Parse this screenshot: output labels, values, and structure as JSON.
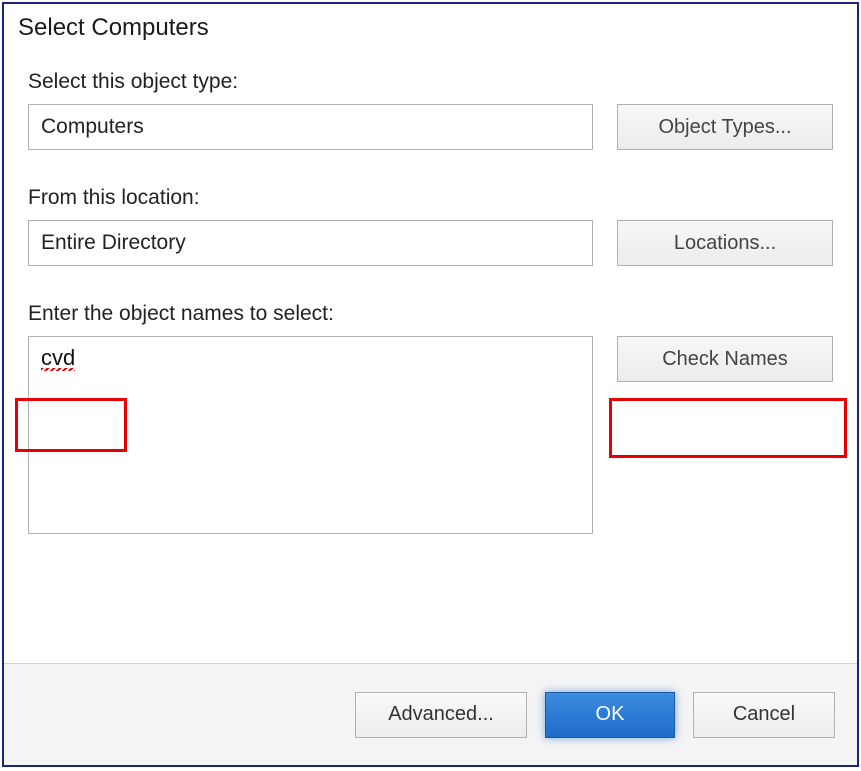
{
  "dialog": {
    "title": "Select Computers",
    "object_type_label": "Select this object type:",
    "object_type_value": "Computers",
    "object_types_button": "Object Types...",
    "location_label": "From this location:",
    "location_value": "Entire Directory",
    "locations_button": "Locations...",
    "names_label": "Enter the object names to select:",
    "names_value": "cvd",
    "check_names_button": "Check Names",
    "advanced_button": "Advanced...",
    "ok_button": "OK",
    "cancel_button": "Cancel"
  }
}
